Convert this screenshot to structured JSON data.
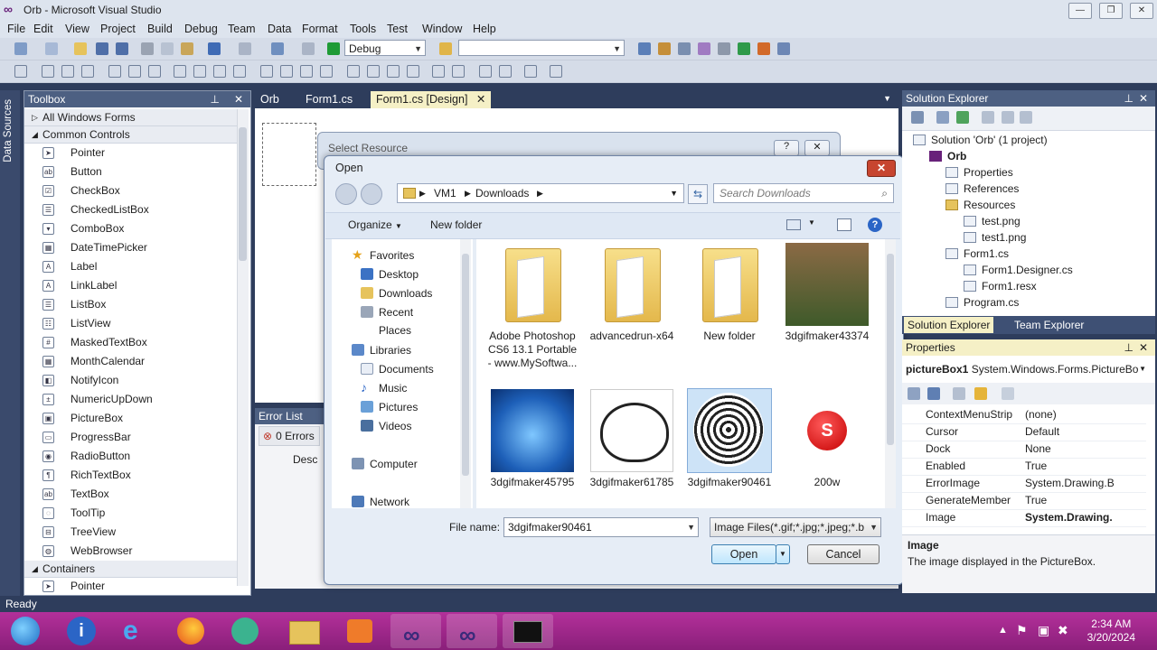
{
  "window": {
    "title": "Orb - Microsoft Visual Studio"
  },
  "menu": [
    "File",
    "Edit",
    "View",
    "Project",
    "Build",
    "Debug",
    "Team",
    "Data",
    "Format",
    "Tools",
    "Test",
    "Window",
    "Help"
  ],
  "toolbar": {
    "config": "Debug",
    "platform": ""
  },
  "sidetab": {
    "label": "Data Sources"
  },
  "toolbox": {
    "title": "Toolbox",
    "groups": {
      "all": "All Windows Forms",
      "common": "Common Controls",
      "containers": "Containers"
    },
    "items": [
      "Pointer",
      "Button",
      "CheckBox",
      "CheckedListBox",
      "ComboBox",
      "DateTimePicker",
      "Label",
      "LinkLabel",
      "ListBox",
      "ListView",
      "MaskedTextBox",
      "MonthCalendar",
      "NotifyIcon",
      "NumericUpDown",
      "PictureBox",
      "ProgressBar",
      "RadioButton",
      "RichTextBox",
      "TextBox",
      "ToolTip",
      "TreeView",
      "WebBrowser"
    ],
    "next_item": "Pointer"
  },
  "doctabs": [
    "Orb",
    "Form1.cs",
    "Form1.cs [Design]"
  ],
  "errorlist": {
    "title": "Error List",
    "errors": "0 Errors",
    "col": "Desc"
  },
  "select_resource": {
    "title": "Select Resource"
  },
  "open_dialog": {
    "title": "Open",
    "path": [
      "VM1",
      "Downloads"
    ],
    "search_placeholder": "Search Downloads",
    "organize": "Organize",
    "new_folder": "New folder",
    "nav": {
      "favorites": "Favorites",
      "desktop": "Desktop",
      "downloads": "Downloads",
      "recent": "Recent Places",
      "libraries": "Libraries",
      "documents": "Documents",
      "music": "Music",
      "pictures": "Pictures",
      "videos": "Videos",
      "computer": "Computer",
      "network": "Network"
    },
    "files": [
      {
        "name": "Adobe Photoshop CS6 13.1 Portable - www.MySoftwa..."
      },
      {
        "name": "advancedrun-x64"
      },
      {
        "name": "New folder"
      },
      {
        "name": "3dgifmaker43374"
      },
      {
        "name": "3dgifmaker45795"
      },
      {
        "name": "3dgifmaker61785"
      },
      {
        "name": "3dgifmaker90461"
      },
      {
        "name": "200w"
      }
    ],
    "thumb_text_200w": "S",
    "file_name_label": "File name:",
    "file_name_value": "3dgifmaker90461",
    "filter": "Image Files(*.gif;*.jpg;*.jpeg;*.b",
    "open_btn": "Open",
    "cancel_btn": "Cancel"
  },
  "solution_explorer": {
    "title": "Solution Explorer",
    "items": [
      "Solution 'Orb' (1 project)",
      "Orb",
      "Properties",
      "References",
      "Resources",
      "test.png",
      "test1.png",
      "Form1.cs",
      "Form1.Designer.cs",
      "Form1.resx",
      "Program.cs"
    ],
    "tab1": "Solution Explorer",
    "tab2": "Team Explorer"
  },
  "properties": {
    "title": "Properties",
    "object": "pictureBox1",
    "object_type": "System.Windows.Forms.PictureBo",
    "rows": [
      {
        "n": "ContextMenuStrip",
        "v": "(none)"
      },
      {
        "n": "Cursor",
        "v": "Default"
      },
      {
        "n": "Dock",
        "v": "None"
      },
      {
        "n": "Enabled",
        "v": "True"
      },
      {
        "n": "ErrorImage",
        "v": "System.Drawing.B"
      },
      {
        "n": "GenerateMember",
        "v": "True"
      },
      {
        "n": "Image",
        "v": "System.Drawing."
      }
    ],
    "desc_title": "Image",
    "desc_text": "The image displayed in the PictureBox."
  },
  "status": {
    "text": "Ready"
  },
  "taskbar": {
    "time": "2:34 AM",
    "date": "3/20/2024"
  },
  "colors": {
    "accent": "#68217a",
    "panel_header": "#4d6082",
    "taskbar": "#a52a8e"
  }
}
